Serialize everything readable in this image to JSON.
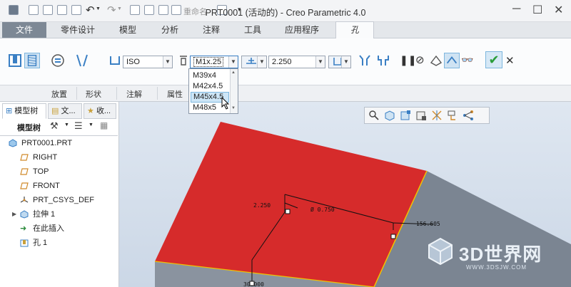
{
  "window": {
    "title": "PRT0001 (活动的) - Creo Parametric 4.0"
  },
  "quick_access": {
    "rename_label": "重命名"
  },
  "tabs": [
    {
      "label": "文件"
    },
    {
      "label": "零件设计"
    },
    {
      "label": "模型"
    },
    {
      "label": "分析"
    },
    {
      "label": "注释"
    },
    {
      "label": "工具"
    },
    {
      "label": "应用程序"
    },
    {
      "label": "孔"
    }
  ],
  "ribbon": {
    "standard_value": "ISO",
    "screw_size_value": "M1x.25",
    "depth_value": "2.250",
    "groups": [
      "放置",
      "形状",
      "注解",
      "属性"
    ]
  },
  "screw_size_dropdown": {
    "options": [
      "M39x4",
      "M42x4.5",
      "M45x4.5",
      "M48x5"
    ],
    "highlighted_index": 2
  },
  "model_tree": {
    "tabs": [
      "模型树",
      "文...",
      "收..."
    ],
    "toolbar_label": "模型树",
    "items": [
      {
        "label": "PRT0001.PRT",
        "icon": "part-icon"
      },
      {
        "label": "RIGHT",
        "icon": "datum-plane-icon"
      },
      {
        "label": "TOP",
        "icon": "datum-plane-icon"
      },
      {
        "label": "FRONT",
        "icon": "datum-plane-icon"
      },
      {
        "label": "PRT_CSYS_DEF",
        "icon": "csys-icon"
      },
      {
        "label": "拉伸 1",
        "icon": "extrude-icon"
      },
      {
        "label": "在此插入",
        "icon": "insert-here-icon"
      },
      {
        "label": "孔 1",
        "icon": "hole-icon"
      }
    ]
  },
  "viewport": {
    "dimensions": {
      "left": "2.250",
      "diameter": "Ø 0.750",
      "right": "156.605",
      "bottom": "30.000"
    },
    "colors": {
      "top_face": "#d62b2b",
      "side_face": "#7b8592",
      "edge_highlight": "#f2c200"
    }
  },
  "watermark": {
    "brand": "3D世界网",
    "url": "WWW.3DSJW.COM"
  }
}
